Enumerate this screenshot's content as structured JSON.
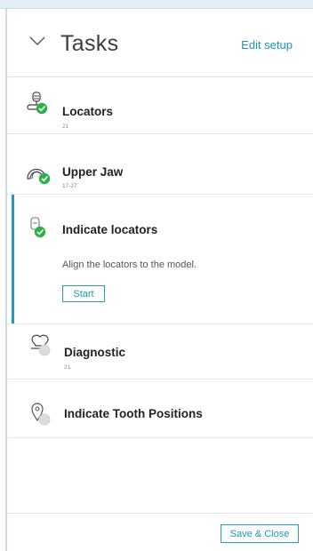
{
  "header": {
    "title": "Tasks",
    "edit_setup": "Edit setup"
  },
  "tasks": [
    {
      "name": "Locators",
      "sub": "21",
      "status": "done",
      "icon": "locator-icon"
    },
    {
      "name": "Upper Jaw",
      "sub": "17-27",
      "status": "done",
      "icon": "upper-jaw-icon"
    },
    {
      "name": "Indicate locators",
      "sub": "",
      "status": "active-done",
      "icon": "indicate-locator-icon",
      "description": "Align the locators to the model.",
      "button": "Start"
    },
    {
      "name": "Diagnostic",
      "sub": "21",
      "status": "pending",
      "icon": "tooth-icon"
    },
    {
      "name": "Indicate Tooth Positions",
      "sub": "",
      "status": "pending",
      "icon": "map-pin-icon"
    }
  ],
  "footer": {
    "save_close": "Save & Close"
  },
  "colors": {
    "accent": "#1e95b0",
    "done": "#2bb04a",
    "pending": "#d9d9d9"
  }
}
